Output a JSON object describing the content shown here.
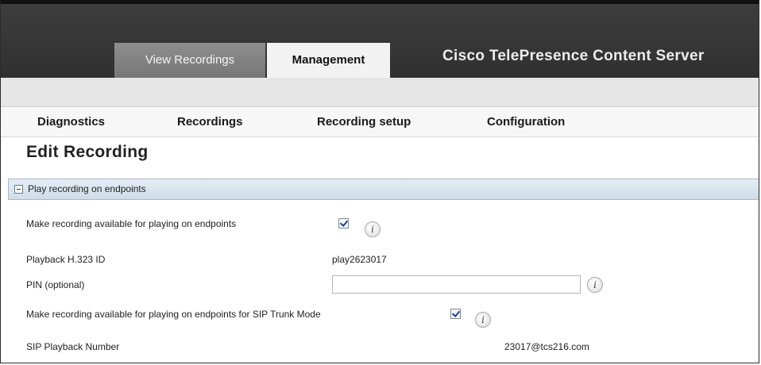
{
  "header": {
    "tabs": [
      {
        "label": "View Recordings",
        "active": false
      },
      {
        "label": "Management",
        "active": true
      }
    ],
    "app_title": "Cisco TelePresence Content Server"
  },
  "menu": {
    "items": [
      "Diagnostics",
      "Recordings",
      "Recording setup",
      "Configuration"
    ]
  },
  "page": {
    "title": "Edit Recording"
  },
  "section": {
    "title": "Play recording on endpoints",
    "fields": {
      "make_available": {
        "label": "Make recording available for playing on endpoints",
        "checked": true
      },
      "playback_id": {
        "label": "Playback H.323 ID",
        "value": "play2623017"
      },
      "pin": {
        "label": "PIN (optional)",
        "value": "",
        "placeholder": ""
      },
      "sip_trunk": {
        "label": "Make recording available for playing on endpoints for SIP Trunk Mode",
        "checked": true
      },
      "sip_number": {
        "label": "SIP Playback Number",
        "value": "23017@tcs216.com"
      }
    },
    "info_glyph": "i"
  },
  "colors": {
    "header_bg": "#333333",
    "active_tab_bg": "#f2f2f2",
    "inactive_tab_bg": "#808080",
    "section_bg": "#d9e4ed"
  },
  "icons": [
    "collapse-icon",
    "info-icon",
    "checkbox-checked"
  ]
}
